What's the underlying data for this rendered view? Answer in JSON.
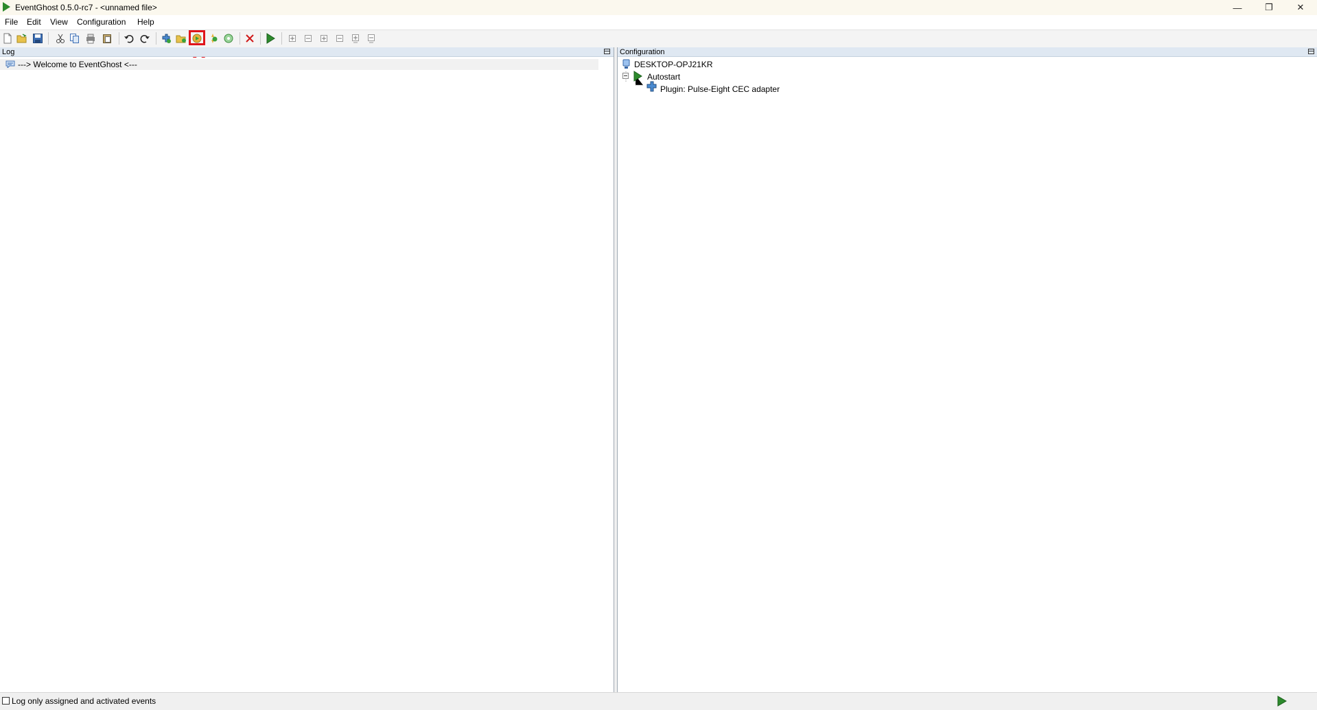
{
  "window": {
    "title": "EventGhost 0.5.0-rc7 - <unnamed file>",
    "controls": {
      "minimize": "—",
      "restore": "❐",
      "close": "✕"
    }
  },
  "menu": [
    "File",
    "Edit",
    "View",
    "Configuration",
    "Help"
  ],
  "toolbar": {
    "buttons": [
      {
        "icon": "new-file-icon"
      },
      {
        "icon": "open-folder-icon"
      },
      {
        "icon": "save-icon"
      },
      {
        "icon": "cut-icon"
      },
      {
        "icon": "copy-icon"
      },
      {
        "icon": "python-icon"
      },
      {
        "icon": "paste-icon"
      },
      {
        "icon": "undo-icon"
      },
      {
        "icon": "redo-icon"
      },
      {
        "icon": "add-plugin-icon"
      },
      {
        "icon": "add-folder-icon"
      },
      {
        "icon": "add-macro-icon",
        "highlighted": true
      },
      {
        "icon": "add-event-icon"
      },
      {
        "icon": "add-action-icon"
      },
      {
        "icon": "delete-icon"
      },
      {
        "icon": "execute-icon"
      },
      {
        "icon": "expand-icon"
      },
      {
        "icon": "collapse-icon"
      },
      {
        "icon": "expand-children-icon"
      },
      {
        "icon": "collapse-children-icon"
      },
      {
        "icon": "expand-all-icon"
      },
      {
        "icon": "collapse-all-icon"
      }
    ]
  },
  "log": {
    "header": "Log",
    "entries": [
      {
        "icon": "info-icon",
        "text": "---> Welcome to EventGhost <---"
      }
    ],
    "log_only_label": "Log only assigned and activated events",
    "log_only_checked": false
  },
  "configuration": {
    "header": "Configuration",
    "tree": {
      "root": "DESKTOP-OPJ21KR",
      "autostart": "Autostart",
      "plugin": "Plugin: Pulse-Eight CEC adapter"
    }
  },
  "colors": {
    "accent_green": "#2d8a2d",
    "highlight_red": "#e0141b",
    "panel_header": "#dfe8f2"
  }
}
